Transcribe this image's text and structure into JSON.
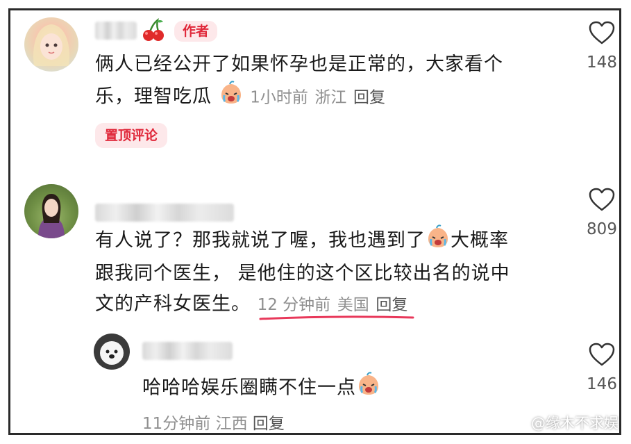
{
  "comments": [
    {
      "author_badge": "作者",
      "text_line1": "俩人已经公开了如果怀孕也是正常的，大家看个",
      "text_line2": "乐，理智吃瓜",
      "time": "1小时前",
      "location": "浙江",
      "reply": "回复",
      "pinned": "置顶评论",
      "likes": "148"
    },
    {
      "text_line1": "有人说了？那我就说了喔，我也遇到了",
      "text_line1_tail": "大概率",
      "text_line2": "跟我同个医生， 是他住的这个区比较出名的说中",
      "text_line3": "文的产科女医生。",
      "time": "12 分钟前",
      "location": "美国",
      "reply": "回复",
      "likes": "809",
      "highlight_color": "#e8385a"
    },
    {
      "text": "哈哈哈娱乐圈瞒不住一点",
      "time": "11分钟前",
      "location": "江西",
      "reply": "回复",
      "likes": "146"
    }
  ],
  "watermark": "@缘木不求娱",
  "icons": [
    "heart-outline-icon",
    "cherry-icon",
    "crying-emoji-icon",
    "weibo-logo-icon"
  ],
  "colors": {
    "accent": "#e0283a",
    "badge_bg": "#fde8ea",
    "meta": "#8f8f8f"
  }
}
